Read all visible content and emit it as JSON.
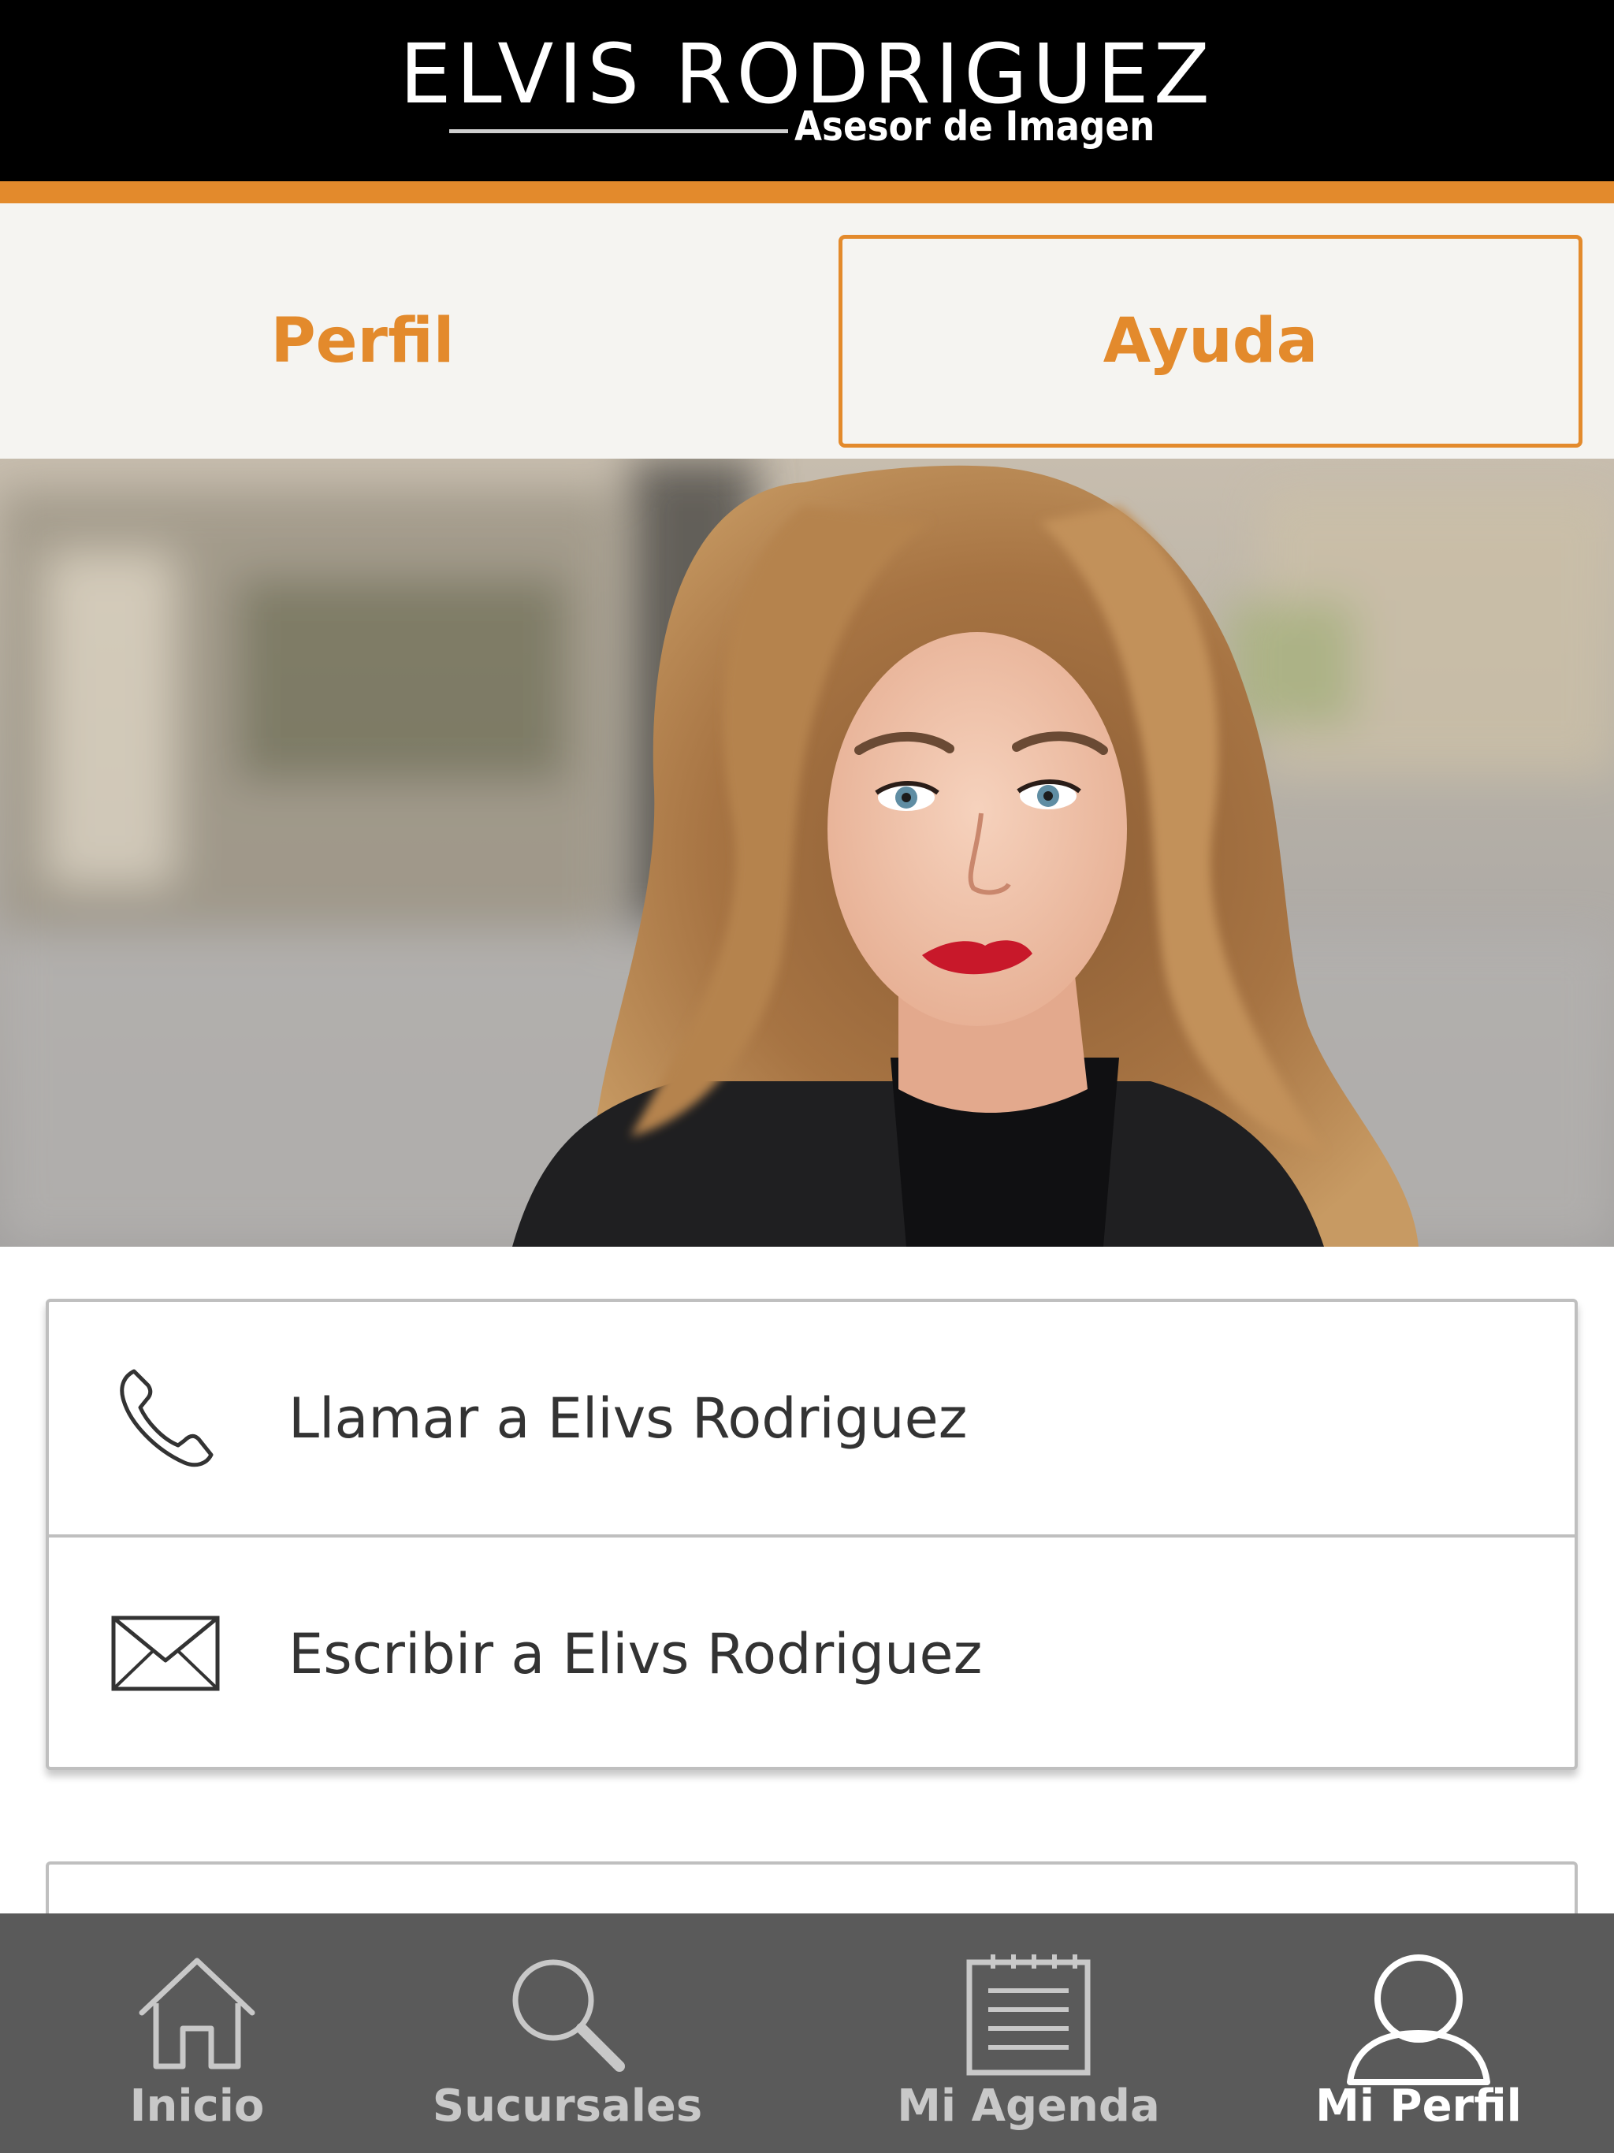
{
  "header": {
    "brand_name": "ELVIS RODRIGUEZ",
    "brand_subtitle": "Asesor de Imagen",
    "background": "#000000",
    "accent_color": "#e38a2c"
  },
  "tabs": [
    {
      "label": "Perfil",
      "selected": false
    },
    {
      "label": "Ayuda",
      "selected": true
    }
  ],
  "hero": {
    "icon": "profile-photo"
  },
  "contact": {
    "call": {
      "icon": "phone-icon",
      "label": "Llamar a Elivs Rodriguez"
    },
    "email": {
      "icon": "mail-icon",
      "label": "Escribir a Elivs Rodriguez"
    }
  },
  "bottom_nav": {
    "background": "#5a5a5a",
    "items": [
      {
        "icon": "home-icon",
        "label": "Inicio",
        "active": false
      },
      {
        "icon": "search-icon",
        "label": "Sucursales",
        "active": false
      },
      {
        "icon": "calendar-icon",
        "label": "Mi Agenda",
        "active": false
      },
      {
        "icon": "user-icon",
        "label": "Mi Perfil",
        "active": true
      }
    ]
  }
}
